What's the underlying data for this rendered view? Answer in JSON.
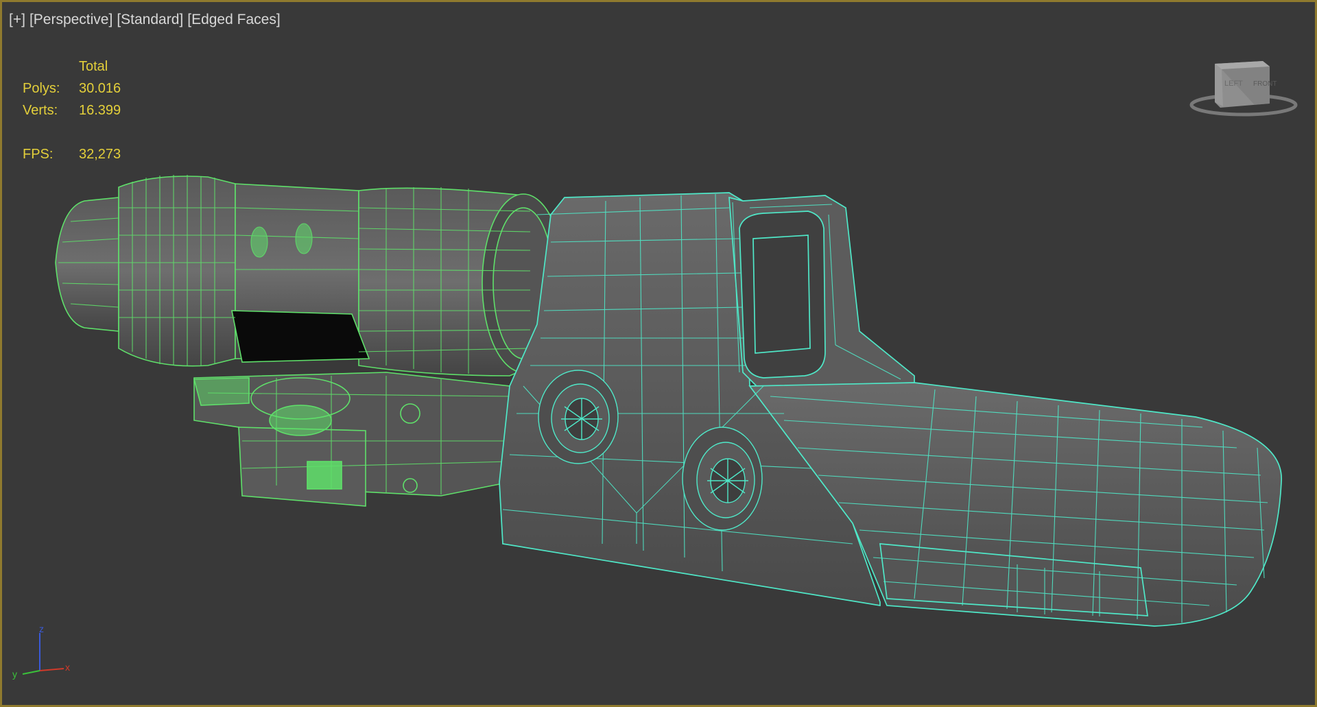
{
  "viewport": {
    "labels": [
      "[+]",
      "[Perspective]",
      "[Standard]",
      "[Edged Faces]"
    ]
  },
  "stats": {
    "header": "Total",
    "polys_label": "Polys:",
    "polys_value": "30.016",
    "verts_label": "Verts:",
    "verts_value": "16.399",
    "fps_label": "FPS:",
    "fps_value": "32,273"
  },
  "viewcube": {
    "left_face": "LEFT",
    "front_face": "FRONT"
  },
  "axes": {
    "x": "x",
    "y": "y",
    "z": "z"
  },
  "colors": {
    "border": "#8f7a2e",
    "background": "#393939",
    "stats_text": "#e3cf3a",
    "magnifier_wire": "#5fe06a",
    "sight_wire": "#4fe8c8",
    "axis_x": "#d03a2a",
    "axis_y": "#3ac23a",
    "axis_z": "#3a5ad8"
  }
}
